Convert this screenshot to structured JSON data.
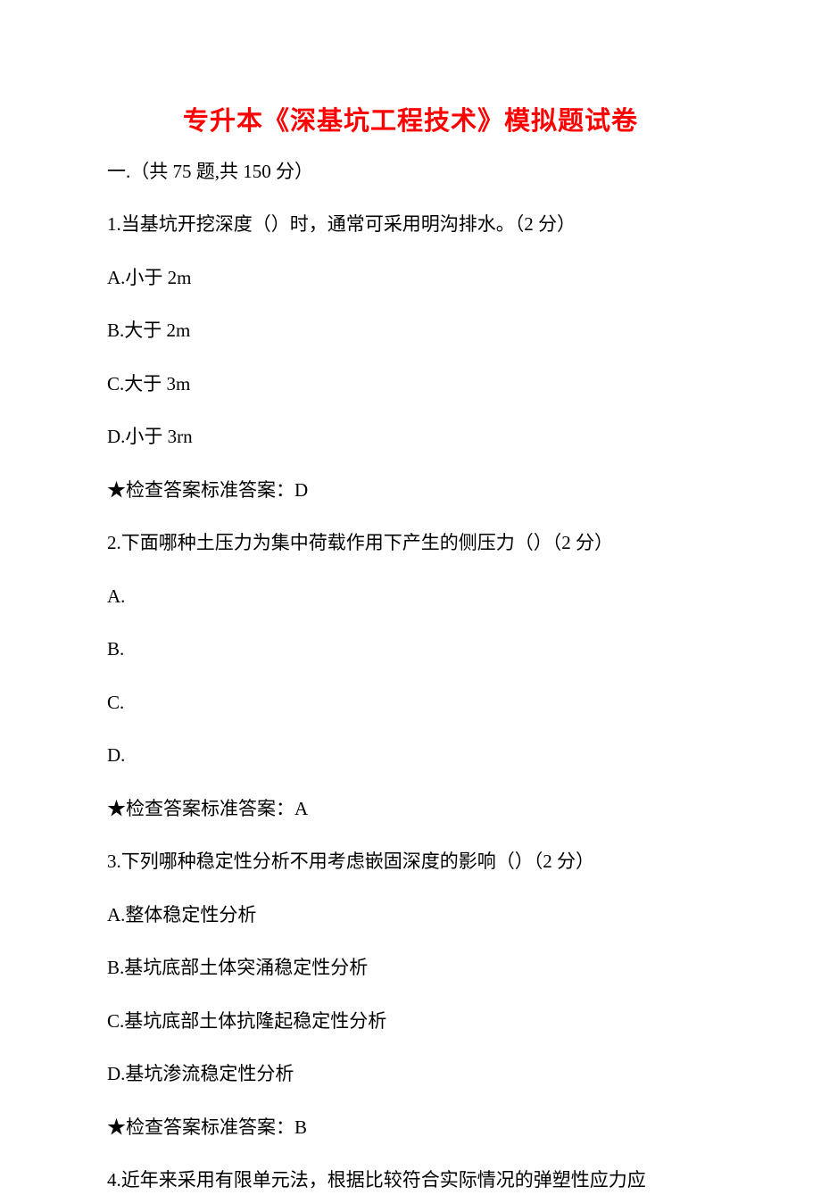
{
  "title": "专升本《深基坑工程技术》模拟题试卷",
  "section_header": "一.（共 75 题,共 150 分）",
  "q1": {
    "text": "1.当基坑开挖深度（）时，通常可采用明沟排水。（2 分）",
    "a": "A.小于 2m",
    "b": "B.大于 2m",
    "c": "C.大于 3m",
    "d": "D.小于 3rn",
    "answer": "★检查答案标准答案：D"
  },
  "q2": {
    "text": "2.下面哪种土压力为集中荷载作用下产生的侧压力（）（2 分）",
    "a": "A.",
    "b": "B.",
    "c": "C.",
    "d": "D.",
    "answer": "★检查答案标准答案：A"
  },
  "q3": {
    "text": "3.下列哪种稳定性分析不用考虑嵌固深度的影响（）（2 分）",
    "a": "A.整体稳定性分析",
    "b": "B.基坑底部土体突涌稳定性分析",
    "c": "C.基坑底部土体抗隆起稳定性分析",
    "d": "D.基坑渗流稳定性分析",
    "answer": "★检查答案标准答案：B"
  },
  "q4": {
    "text": "4.近年来采用有限单元法，根据比较符合实际情况的弹塑性应力应"
  }
}
